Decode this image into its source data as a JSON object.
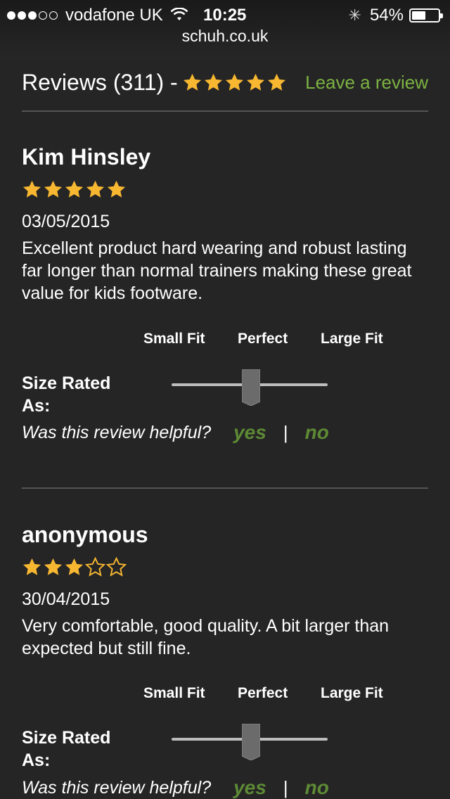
{
  "status_bar": {
    "carrier": "vodafone UK",
    "time": "10:25",
    "battery": "54%",
    "battery_level": 0.54,
    "signal_bars_full": 3,
    "signal_bars_total": 5
  },
  "url": "schuh.co.uk",
  "reviews_header": {
    "title": "Reviews (311) -",
    "rating": 5,
    "leave_review": "Leave a review"
  },
  "fit_scale": {
    "small": "Small Fit",
    "perfect": "Perfect",
    "large": "Large Fit"
  },
  "size_rated_label": "Size Rated As:",
  "helpful": {
    "question": "Was this review helpful?",
    "yes": "yes",
    "separator": "|",
    "no": "no"
  },
  "reviews": [
    {
      "name": "Kim Hinsley",
      "rating": 5,
      "date": "03/05/2015",
      "text": "Excellent product hard wearing and robust lasting far longer than normal trainers making these great value for kids footware.",
      "fit": 0.5
    },
    {
      "name": "anonymous",
      "rating": 3,
      "date": "30/04/2015",
      "text": "Very comfortable, good quality. A bit larger than expected but still fine.",
      "fit": 0.5
    }
  ],
  "colors": {
    "background": "#252525",
    "star": "#f7b731",
    "accent_green": "#7cb342",
    "helpful_green": "#5d8a35",
    "divider": "#555555"
  },
  "icons": {
    "wifi": "wifi-icon",
    "activity": "activity-spinner-icon",
    "battery": "battery-icon",
    "star": "star-icon",
    "slider": "slider-thumb-icon"
  }
}
